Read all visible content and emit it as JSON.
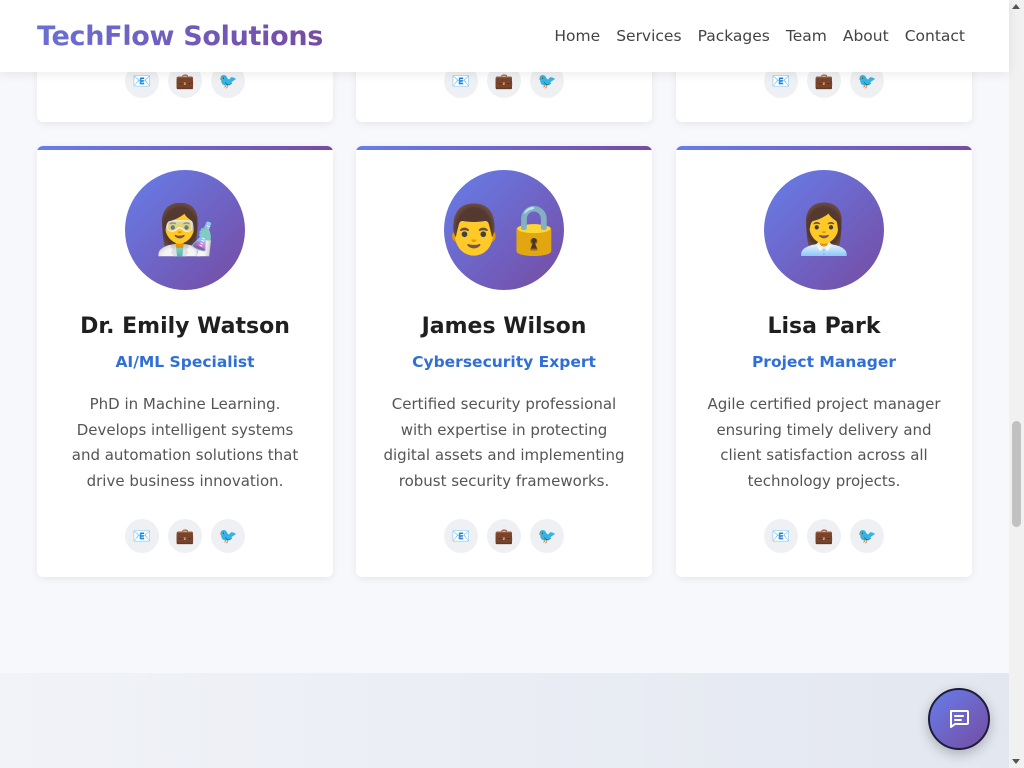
{
  "header": {
    "logo": "TechFlow Solutions",
    "nav": [
      "Home",
      "Services",
      "Packages",
      "Team",
      "About",
      "Contact"
    ]
  },
  "social_icons": [
    {
      "icon": "email-icon",
      "glyph": "📧"
    },
    {
      "icon": "briefcase-icon",
      "glyph": "💼"
    },
    {
      "icon": "bird-icon",
      "glyph": "🐦"
    }
  ],
  "team": [
    {
      "avatar_glyph": "👩‍🔬",
      "name": "Dr. Emily Watson",
      "role": "AI/ML Specialist",
      "bio": "PhD in Machine Learning. Develops intelligent systems and automation solutions that drive business innovation."
    },
    {
      "avatar_glyph": "👨🔒",
      "name": "James Wilson",
      "role": "Cybersecurity Expert",
      "bio": "Certified security professional with expertise in protecting digital assets and implementing robust security frameworks."
    },
    {
      "avatar_glyph": "👩‍💼",
      "name": "Lisa Park",
      "role": "Project Manager",
      "bio": "Agile certified project manager ensuring timely delivery and client satisfaction across all technology projects."
    }
  ],
  "colors": {
    "accent_gradient_start": "#667eea",
    "accent_gradient_end": "#764ba2",
    "role_text": "#2f6fd6"
  },
  "chat": {
    "icon": "chat-icon"
  }
}
